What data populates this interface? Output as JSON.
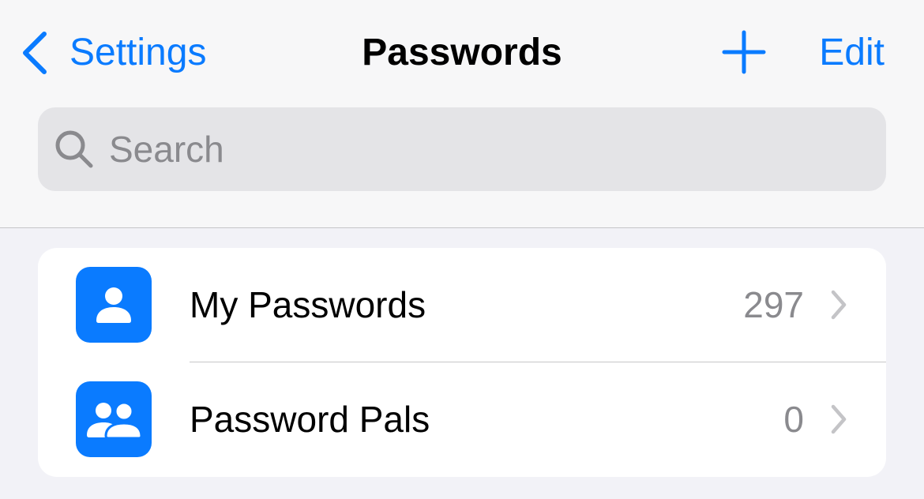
{
  "nav": {
    "back_label": "Settings",
    "title": "Passwords",
    "edit_label": "Edit",
    "add_icon": "plus-icon",
    "back_icon": "chevron-left-icon"
  },
  "search": {
    "placeholder": "Search",
    "value": "",
    "icon": "magnifying-glass-icon"
  },
  "list": {
    "items": [
      {
        "label": "My Passwords",
        "count": "297",
        "icon": "person-icon"
      },
      {
        "label": "Password Pals",
        "count": "0",
        "icon": "two-people-icon"
      }
    ]
  },
  "colors": {
    "accent": "#0a7bff",
    "background": "#f2f2f7",
    "secondary_text": "#8a8a8e"
  }
}
